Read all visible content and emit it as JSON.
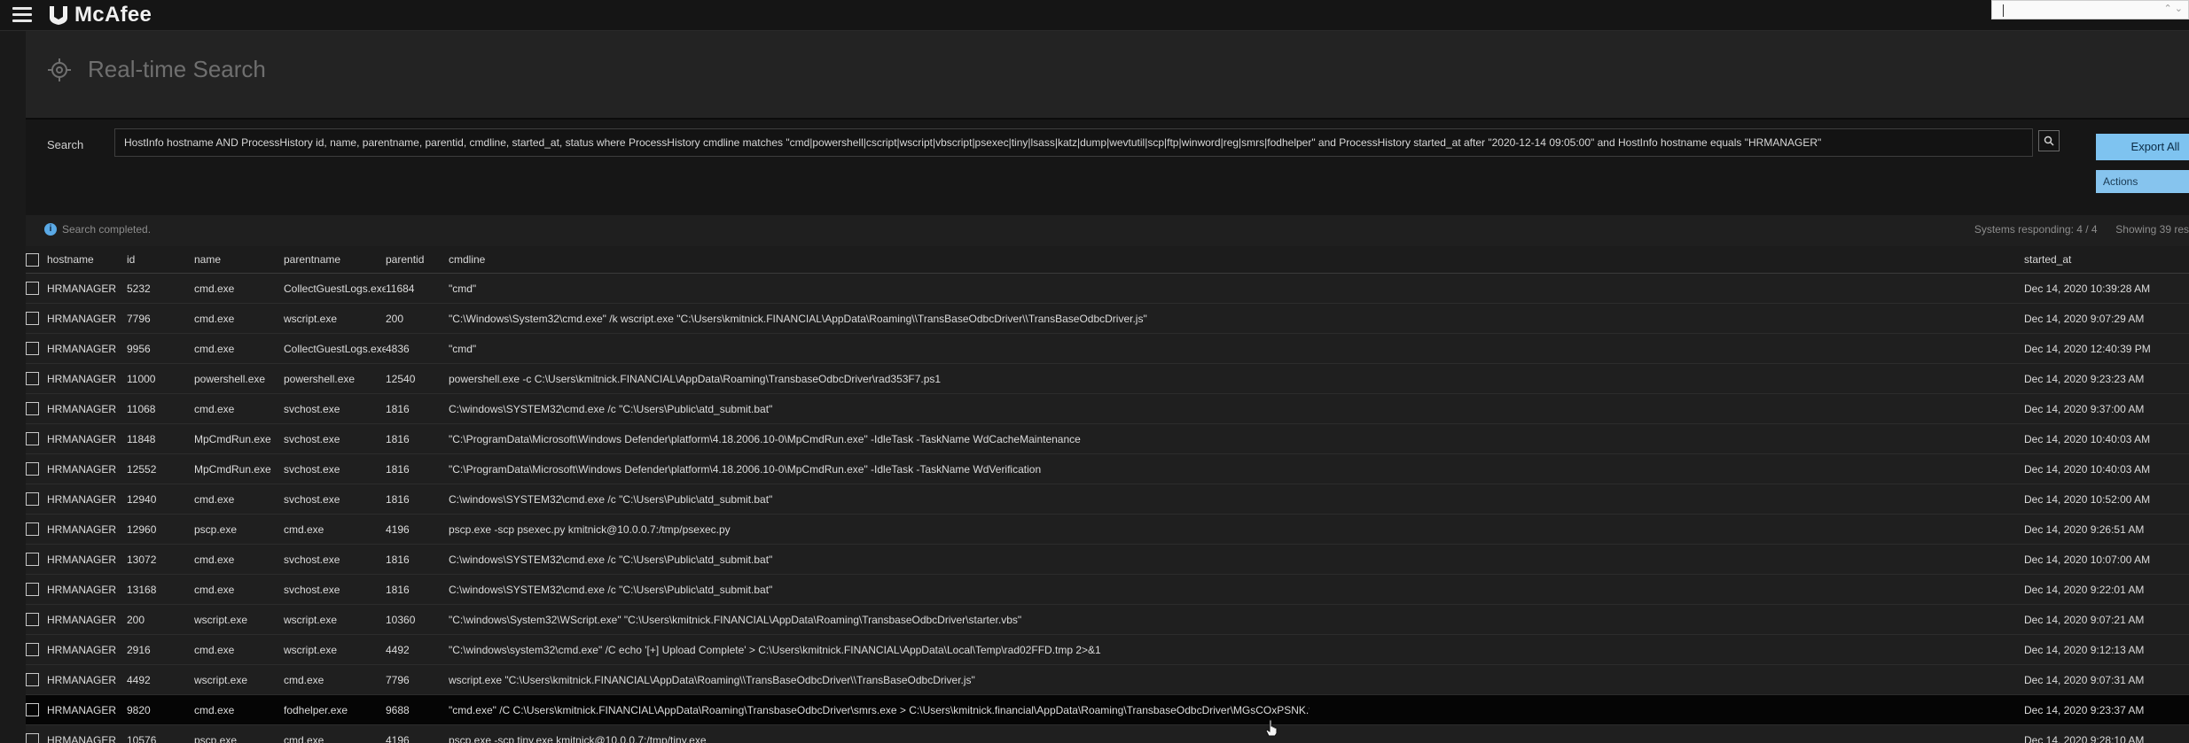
{
  "app": {
    "brand": "McAfee",
    "colors": {
      "accent": "#7ec3f0",
      "background": "#1f1f1f",
      "topbar": "#151515",
      "info": "#5aa9e6"
    }
  },
  "header": {
    "title": "Real-time Search",
    "icon": "target-icon"
  },
  "search": {
    "label": "Search",
    "query": "HostInfo hostname AND ProcessHistory id, name, parentname, parentid, cmdline, started_at, status where ProcessHistory cmdline matches \"cmd|powershell|cscript|wscript|vbscript|psexec|tiny|lsass|katz|dump|wevtutil|scp|ftp|winword|reg|smrs|fodhelper\" and ProcessHistory started_at after \"2020-12-14 09:05:00\" and HostInfo hostname equals \"HRMANAGER\"",
    "export_label": "Export All",
    "actions_label": "Actions"
  },
  "status": {
    "message": "Search completed.",
    "responding": "Systems responding: 4 / 4",
    "showing": "Showing 39 res"
  },
  "table": {
    "columns": [
      "hostname",
      "id",
      "name",
      "parentname",
      "parentid",
      "cmdline",
      "started_at"
    ],
    "rows": [
      [
        "HRMANAGER",
        "5232",
        "cmd.exe",
        "CollectGuestLogs.exe",
        "11684",
        "\"cmd\"",
        "Dec 14, 2020 10:39:28 AM"
      ],
      [
        "HRMANAGER",
        "7796",
        "cmd.exe",
        "wscript.exe",
        "200",
        "\"C:\\Windows\\System32\\cmd.exe\" /k wscript.exe \"C:\\Users\\kmitnick.FINANCIAL\\AppData\\Roaming\\\\TransBaseOdbcDriver\\\\TransBaseOdbcDriver.js\"",
        "Dec 14, 2020 9:07:29 AM"
      ],
      [
        "HRMANAGER",
        "9956",
        "cmd.exe",
        "CollectGuestLogs.exe",
        "4836",
        "\"cmd\"",
        "Dec 14, 2020 12:40:39 PM"
      ],
      [
        "HRMANAGER",
        "11000",
        "powershell.exe",
        "powershell.exe",
        "12540",
        "powershell.exe -c C:\\Users\\kmitnick.FINANCIAL\\AppData\\Roaming\\TransbaseOdbcDriver\\rad353F7.ps1",
        "Dec 14, 2020 9:23:23 AM"
      ],
      [
        "HRMANAGER",
        "11068",
        "cmd.exe",
        "svchost.exe",
        "1816",
        "C:\\windows\\SYSTEM32\\cmd.exe /c \"C:\\Users\\Public\\atd_submit.bat\"",
        "Dec 14, 2020 9:37:00 AM"
      ],
      [
        "HRMANAGER",
        "11848",
        "MpCmdRun.exe",
        "svchost.exe",
        "1816",
        "\"C:\\ProgramData\\Microsoft\\Windows Defender\\platform\\4.18.2006.10-0\\MpCmdRun.exe\" -IdleTask -TaskName WdCacheMaintenance",
        "Dec 14, 2020 10:40:03 AM"
      ],
      [
        "HRMANAGER",
        "12552",
        "MpCmdRun.exe",
        "svchost.exe",
        "1816",
        "\"C:\\ProgramData\\Microsoft\\Windows Defender\\platform\\4.18.2006.10-0\\MpCmdRun.exe\" -IdleTask -TaskName WdVerification",
        "Dec 14, 2020 10:40:03 AM"
      ],
      [
        "HRMANAGER",
        "12940",
        "cmd.exe",
        "svchost.exe",
        "1816",
        "C:\\windows\\SYSTEM32\\cmd.exe /c \"C:\\Users\\Public\\atd_submit.bat\"",
        "Dec 14, 2020 10:52:00 AM"
      ],
      [
        "HRMANAGER",
        "12960",
        "pscp.exe",
        "cmd.exe",
        "4196",
        "pscp.exe -scp psexec.py kmitnick@10.0.0.7:/tmp/psexec.py",
        "Dec 14, 2020 9:26:51 AM"
      ],
      [
        "HRMANAGER",
        "13072",
        "cmd.exe",
        "svchost.exe",
        "1816",
        "C:\\windows\\SYSTEM32\\cmd.exe /c \"C:\\Users\\Public\\atd_submit.bat\"",
        "Dec 14, 2020 10:07:00 AM"
      ],
      [
        "HRMANAGER",
        "13168",
        "cmd.exe",
        "svchost.exe",
        "1816",
        "C:\\windows\\SYSTEM32\\cmd.exe /c \"C:\\Users\\Public\\atd_submit.bat\"",
        "Dec 14, 2020 9:22:01 AM"
      ],
      [
        "HRMANAGER",
        "200",
        "wscript.exe",
        "wscript.exe",
        "10360",
        "\"C:\\windows\\System32\\WScript.exe\" \"C:\\Users\\kmitnick.FINANCIAL\\AppData\\Roaming\\TransbaseOdbcDriver\\starter.vbs\"",
        "Dec 14, 2020 9:07:21 AM"
      ],
      [
        "HRMANAGER",
        "2916",
        "cmd.exe",
        "wscript.exe",
        "4492",
        "\"C:\\windows\\system32\\cmd.exe\" /C echo '[+] Upload Complete' > C:\\Users\\kmitnick.FINANCIAL\\AppData\\Local\\Temp\\rad02FFD.tmp 2>&1",
        "Dec 14, 2020 9:12:13 AM"
      ],
      [
        "HRMANAGER",
        "4492",
        "wscript.exe",
        "cmd.exe",
        "7796",
        "wscript.exe \"C:\\Users\\kmitnick.FINANCIAL\\AppData\\Roaming\\\\TransBaseOdbcDriver\\\\TransBaseOdbcDriver.js\"",
        "Dec 14, 2020 9:07:31 AM"
      ],
      [
        "HRMANAGER",
        "9820",
        "cmd.exe",
        "fodhelper.exe",
        "9688",
        "\"cmd.exe\" /C C:\\Users\\kmitnick.FINANCIAL\\AppData\\Roaming\\TransbaseOdbcDriver\\smrs.exe > C:\\Users\\kmitnick.financial\\AppData\\Roaming\\TransbaseOdbcDriver\\MGsCOxPSNK.txt",
        "Dec 14, 2020 9:23:37 AM"
      ],
      [
        "HRMANAGER",
        "10576",
        "pscp.exe",
        "cmd.exe",
        "4196",
        "pscp.exe -scp tiny.exe kmitnick@10.0.0.7:/tmp/tiny.exe",
        "Dec 14, 2020 9:28:10 AM"
      ]
    ]
  }
}
